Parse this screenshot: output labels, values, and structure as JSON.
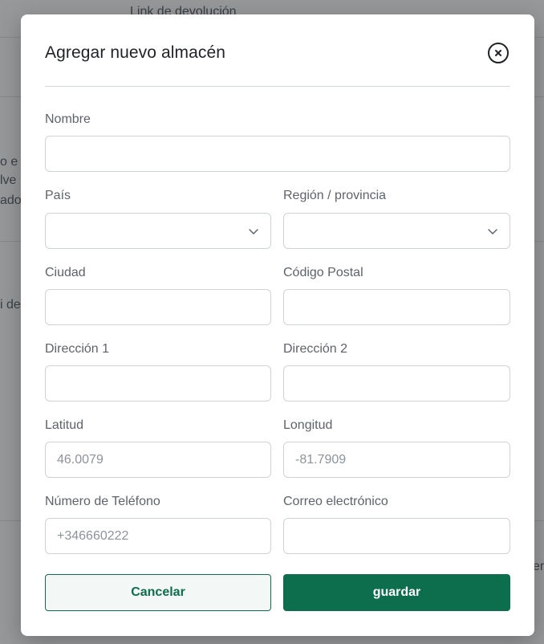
{
  "background": {
    "fragments": [
      "Link de devolución",
      "o e",
      "lve",
      "ado",
      "i dev",
      "er"
    ]
  },
  "modal": {
    "title": "Agregar nuevo almacén",
    "close_icon": "close-circle-icon",
    "fields": {
      "nombre": {
        "label": "Nombre",
        "value": "",
        "placeholder": ""
      },
      "pais": {
        "label": "País",
        "value": ""
      },
      "region": {
        "label": "Región / provincia",
        "value": ""
      },
      "ciudad": {
        "label": "Ciudad",
        "value": "",
        "placeholder": ""
      },
      "codigo_postal": {
        "label": "Código Postal",
        "value": "",
        "placeholder": ""
      },
      "direccion1": {
        "label": "Dirección 1",
        "value": "",
        "placeholder": ""
      },
      "direccion2": {
        "label": "Dirección 2",
        "value": "",
        "placeholder": ""
      },
      "latitud": {
        "label": "Latitud",
        "value": "",
        "placeholder": "46.0079"
      },
      "longitud": {
        "label": "Longitud",
        "value": "",
        "placeholder": "-81.7909"
      },
      "telefono": {
        "label": "Número de Teléfono",
        "value": "",
        "placeholder": "+346660222"
      },
      "correo": {
        "label": "Correo electrónico",
        "value": "",
        "placeholder": ""
      }
    },
    "buttons": {
      "cancel": "Cancelar",
      "save": "guardar"
    }
  },
  "colors": {
    "primary": "#0d6e4d",
    "border": "#cfd3d8",
    "label": "#5d636b"
  }
}
